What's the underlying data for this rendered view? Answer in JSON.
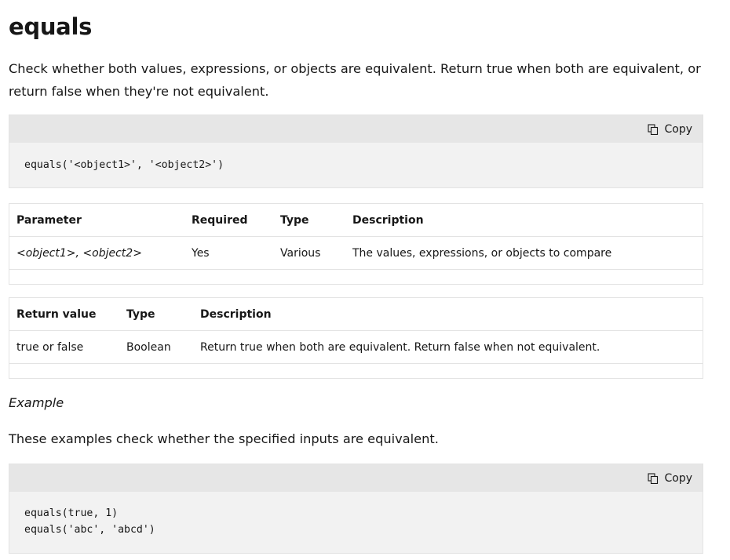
{
  "title": "equals",
  "intro": "Check whether both values, expressions, or objects are equivalent. Return true when both are equivalent, or return false when they're not equivalent.",
  "copy_label": "Copy",
  "syntax_code": "equals('<object1>', '<object2>')",
  "param_table": {
    "headers": [
      "Parameter",
      "Required",
      "Type",
      "Description"
    ],
    "rows": [
      [
        "<object1>, <object2>",
        "Yes",
        "Various",
        "The values, expressions, or objects to compare"
      ]
    ]
  },
  "return_table": {
    "headers": [
      "Return value",
      "Type",
      "Description"
    ],
    "rows": [
      [
        "true or false",
        "Boolean",
        "Return true when both are equivalent. Return false when not equivalent."
      ]
    ]
  },
  "example_heading": "Example",
  "example_text": "These examples check whether the specified inputs are equivalent.",
  "example_code": "equals(true, 1)\nequals('abc', 'abcd')"
}
